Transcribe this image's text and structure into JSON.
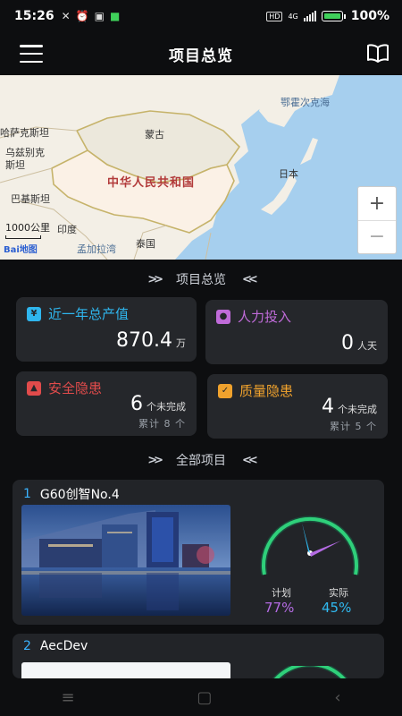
{
  "status": {
    "time": "15:26",
    "network": "4G",
    "battery": "100%"
  },
  "navbar": {
    "title": "项目总览"
  },
  "map": {
    "labels": {
      "mongolia": "蒙古",
      "china": "中华人民共和国",
      "japan": "日本",
      "okhotsk": "鄂霍次克海",
      "kazakh": "哈萨克斯坦",
      "uzbek": "乌兹别克",
      "stan": "斯坦",
      "pakistan": "巴基斯坦",
      "india": "印度",
      "bangladesh": "孟加拉湾",
      "thailand": "泰国"
    },
    "scale": "1000公里",
    "logo": "Bai地图",
    "zoom_in": "+",
    "zoom_out": "−"
  },
  "overview": {
    "title": "项目总览",
    "output": {
      "label": "近一年总产值",
      "value": "870.4",
      "unit": "万",
      "color": "#2fb6ee"
    },
    "labor": {
      "label": "人力投入",
      "value": "0",
      "unit": "人天",
      "color": "#c06bd9"
    },
    "safety": {
      "label": "安全隐患",
      "value": "6",
      "unit": "个未完成",
      "sub": "累计 8 个",
      "color": "#e14b4b"
    },
    "quality": {
      "label": "质量隐患",
      "value": "4",
      "unit": "个未完成",
      "sub": "累计 5 个",
      "color": "#f0a22d"
    }
  },
  "all_projects": {
    "title": "全部项目",
    "items": [
      {
        "index": "1",
        "name": "G60创智No.4",
        "plan_label": "计划",
        "actual_label": "实际",
        "plan": "77%",
        "actual": "45%",
        "plan_color": "#b46be3",
        "actual_color": "#30b9f0"
      },
      {
        "index": "2",
        "name": "AecDev"
      }
    ]
  }
}
